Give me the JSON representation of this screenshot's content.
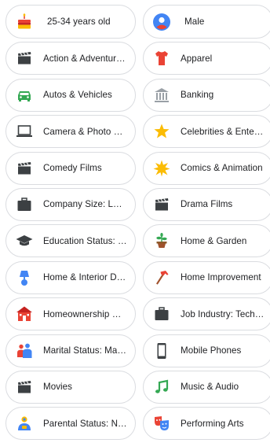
{
  "chips": [
    {
      "label": "25-34 years old",
      "icon": "birthday-cake-icon"
    },
    {
      "label": "Male",
      "icon": "user-avatar-icon"
    },
    {
      "label": "Action & Adventure ...",
      "icon": "clapperboard-icon"
    },
    {
      "label": "Apparel",
      "icon": "tshirt-icon"
    },
    {
      "label": "Autos & Vehicles",
      "icon": "car-icon"
    },
    {
      "label": "Banking",
      "icon": "bank-icon"
    },
    {
      "label": "Camera & Photo Eq...",
      "icon": "laptop-icon"
    },
    {
      "label": "Celebrities & Entert...",
      "icon": "star-icon"
    },
    {
      "label": "Comedy Films",
      "icon": "clapperboard-icon"
    },
    {
      "label": "Comics & Animation",
      "icon": "burst-icon"
    },
    {
      "label": "Company Size: Larg...",
      "icon": "briefcase-icon"
    },
    {
      "label": "Drama Films",
      "icon": "clapperboard-icon"
    },
    {
      "label": "Education Status: B...",
      "icon": "graduation-cap-icon"
    },
    {
      "label": "Home & Garden",
      "icon": "potted-plant-icon"
    },
    {
      "label": "Home & Interior De...",
      "icon": "lamp-icon"
    },
    {
      "label": "Home Improvement",
      "icon": "hammer-icon"
    },
    {
      "label": "Homeownership Sta...",
      "icon": "house-icon"
    },
    {
      "label": "Job Industry: Techn...",
      "icon": "briefcase-icon"
    },
    {
      "label": "Marital Status: Marr...",
      "icon": "couple-icon"
    },
    {
      "label": "Mobile Phones",
      "icon": "mobile-phone-icon"
    },
    {
      "label": "Movies",
      "icon": "clapperboard-icon"
    },
    {
      "label": "Music & Audio",
      "icon": "music-note-icon"
    },
    {
      "label": "Parental Status: Not...",
      "icon": "parent-icon"
    },
    {
      "label": "Performing Arts",
      "icon": "theater-masks-icon"
    }
  ],
  "colors": {
    "chip_border": "#dadce0",
    "text": "#202124",
    "icon_dark": "#3c4043",
    "red": "#ea4335",
    "blue": "#4285f4",
    "green": "#34a853",
    "yellow": "#fbbc04"
  }
}
